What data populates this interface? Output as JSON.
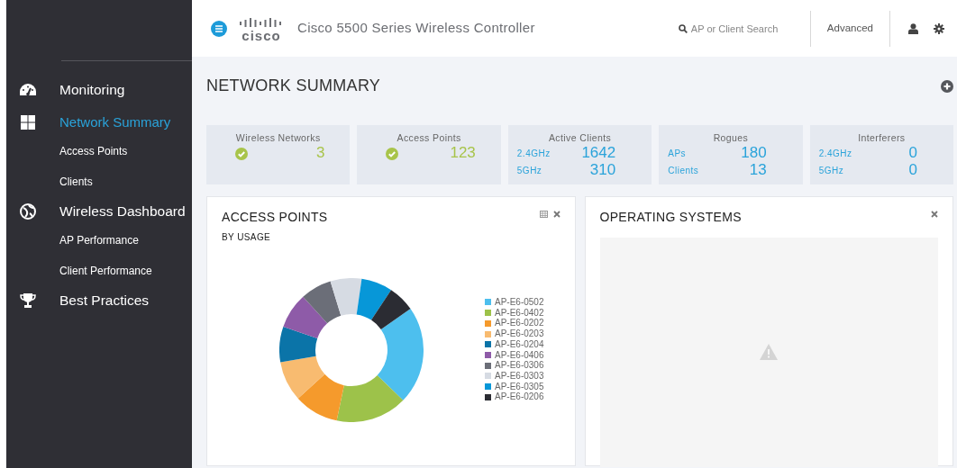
{
  "header": {
    "logo": "cisco",
    "title": "Cisco 5500 Series Wireless Controller",
    "search": {
      "placeholder": "AP or Client Search"
    },
    "advanced": "Advanced"
  },
  "sidebar": {
    "sections": [
      {
        "label": "Monitoring",
        "selected": false
      },
      {
        "label": "Network Summary",
        "selected": true,
        "children": [
          {
            "label": "Access Points",
            "selected": false
          },
          {
            "label": "Clients",
            "selected": false
          }
        ]
      },
      {
        "label": "Wireless Dashboard",
        "selected": false,
        "children": [
          {
            "label": "AP Performance",
            "selected": false
          },
          {
            "label": "Client Performance",
            "selected": false
          }
        ]
      },
      {
        "label": "Best Practices",
        "selected": false
      }
    ]
  },
  "page_title": "NETWORK SUMMARY",
  "tiles": [
    {
      "kind": "status",
      "title": "Wireless Networks",
      "ok": true,
      "value": "3"
    },
    {
      "kind": "status",
      "title": "Access Points",
      "ok": true,
      "value": "123"
    },
    {
      "kind": "split",
      "title": "Active Clients",
      "rows": [
        {
          "label": "2.4GHz",
          "value": "1642"
        },
        {
          "label": "5GHz",
          "value": "310"
        }
      ]
    },
    {
      "kind": "split",
      "title": "Rogues",
      "rows": [
        {
          "label": "APs",
          "value": "180"
        },
        {
          "label": "Clients",
          "value": "13"
        }
      ]
    },
    {
      "kind": "split",
      "title": "Interferers",
      "rows": [
        {
          "label": "2.4GHz",
          "value": "0"
        },
        {
          "label": "5GHz",
          "value": "0"
        }
      ]
    }
  ],
  "panels": [
    {
      "kind": "donut",
      "title": "ACCESS POINTS",
      "subtitle": "BY USAGE",
      "legend": [
        {
          "label": "AP-E6-0502",
          "color": "#4dbfee"
        },
        {
          "label": "AP-E6-0402",
          "color": "#9dc24a"
        },
        {
          "label": "AP-E6-0202",
          "color": "#f59a2c"
        },
        {
          "label": "AP-E6-0203",
          "color": "#f8bb70"
        },
        {
          "label": "AP-E6-0204",
          "color": "#0b74a8"
        },
        {
          "label": "AP-E6-0406",
          "color": "#8e5ba8"
        },
        {
          "label": "AP-E6-0306",
          "color": "#6b6e78"
        },
        {
          "label": "AP-E6-0303",
          "color": "#d6dbe3"
        },
        {
          "label": "AP-E6-0305",
          "color": "#0797d8"
        },
        {
          "label": "AP-E6-0206",
          "color": "#2b2c33"
        }
      ]
    },
    {
      "kind": "empty",
      "title": "OPERATING SYSTEMS"
    }
  ]
}
